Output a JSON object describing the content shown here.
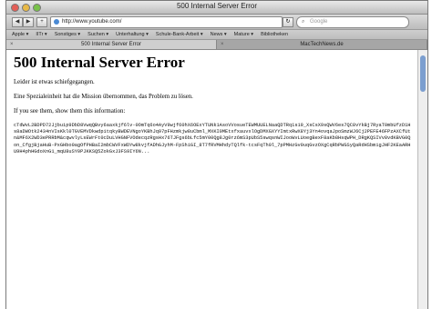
{
  "window": {
    "title": "500 Internal Server Error"
  },
  "toolbar": {
    "back": "◀",
    "forward": "▶",
    "add": "+",
    "url": "http://www.youtube.com/",
    "refresh": "↻",
    "search_placeholder": "Google"
  },
  "bookmarks": [
    "Apple ▾",
    "IITr ▾",
    "Sonstiges ▾",
    "Suchen ▾",
    "Unterhaltung ▾",
    "Schule-Bank-Arbeit ▾",
    "News ▾",
    "Mature ▾",
    "Bibliotheken"
  ],
  "tabs": [
    {
      "label": "500 Internal Server Error"
    },
    {
      "label": "MacTechNews.de"
    }
  ],
  "main": {
    "heading": "500 Internal Server Error",
    "line1": "Leider ist etwas schiefgegangen.",
    "line2": "Eine Spezialeinheit hat die Mission übernommen, das Problem zu lösen.",
    "line3": "If you see them, show them this information:",
    "debug_dump": "cTdWvL2BDPD72Jjbuip9DbD8VwqQBvy6aaxkjf6lv-0OmTq6o4AyV9wjf60hX6OExYTUNk1AsoVVosueTEWMUUELNaaQDTRq1s19_XsCsX9sQWV6es7QC8vYkBj7RyaT0mbUfzD1Hs8aDWOtk2434nVIsKkl0TGVEMVDkwdpitqkyBWDEVNgoYKBhJq97pFHzmkjw8uCbml_MXKI0MEtxfxauvxlOgDMXGXYYImtxRwX8Yj3Yn4ovqaJpoSmzWJ6Cj2PEFE46FPzAXCfUtn&MF6X2WD3ePRRbM&cqwvlyLsEWrFt0cDuLVHGNFVOdecqzRgsHx76TJFgs6bLfc5mY00Qg8Jg0rz6mS3pUbS5swqsnWIJooWvLUoegBexF8aKb8HsqWPH_DRgKQSIVv8vdKBVG0Qon_CfgjBjaHuB-PxGHbo0agOfPHBaI2mbCWVFxWDYw8kvjfADhGJyhM-FpShiGI_8T7fRVMHhdyTQlfk-tcsFqTh0l_7pPMHzGv0uqGvzOXgCqRbPWGSyQaRdHSbmigJHF2KEaARHU9H4phHGdoXnG1_mqU8uSY0PJKKSQ5ZokGxJ3FS9IY6N..."
  }
}
